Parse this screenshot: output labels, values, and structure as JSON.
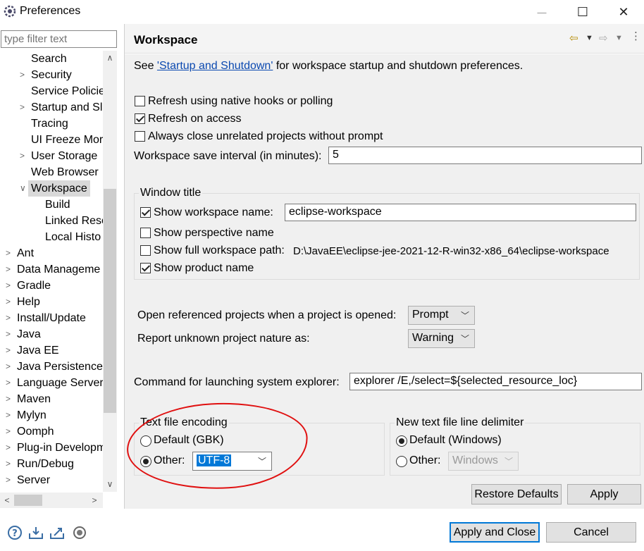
{
  "window": {
    "title": "Preferences",
    "minimize_glyph": "—",
    "maximize_glyph": "☐",
    "close_glyph": "✕"
  },
  "filter": {
    "placeholder": "type filter text"
  },
  "tree": {
    "items": [
      {
        "label": "Search",
        "arrow": ""
      },
      {
        "label": "Security",
        "arrow": ">"
      },
      {
        "label": "Service Policie",
        "arrow": ""
      },
      {
        "label": "Startup and Sl",
        "arrow": ">"
      },
      {
        "label": "Tracing",
        "arrow": ""
      },
      {
        "label": "UI Freeze Mor",
        "arrow": ""
      },
      {
        "label": "User Storage",
        "arrow": ">"
      },
      {
        "label": "Web Browser",
        "arrow": ""
      },
      {
        "label": "Workspace",
        "arrow": "v"
      },
      {
        "label": "Build",
        "arrow": ""
      },
      {
        "label": "Linked Reso",
        "arrow": ""
      },
      {
        "label": "Local Histo",
        "arrow": ""
      },
      {
        "label": "Ant",
        "arrow": ">"
      },
      {
        "label": "Data Manageme",
        "arrow": ">"
      },
      {
        "label": "Gradle",
        "arrow": ">"
      },
      {
        "label": "Help",
        "arrow": ">"
      },
      {
        "label": "Install/Update",
        "arrow": ">"
      },
      {
        "label": "Java",
        "arrow": ">"
      },
      {
        "label": "Java EE",
        "arrow": ">"
      },
      {
        "label": "Java Persistence",
        "arrow": ">"
      },
      {
        "label": "Language Server",
        "arrow": ">"
      },
      {
        "label": "Maven",
        "arrow": ">"
      },
      {
        "label": "Mylyn",
        "arrow": ">"
      },
      {
        "label": "Oomph",
        "arrow": ">"
      },
      {
        "label": "Plug-in Developm",
        "arrow": ">"
      },
      {
        "label": "Run/Debug",
        "arrow": ">"
      },
      {
        "label": "Server",
        "arrow": ">"
      }
    ]
  },
  "page": {
    "title": "Workspace",
    "see_prefix": "See ",
    "see_link": "'Startup and Shutdown'",
    "see_suffix": " for workspace startup and shutdown preferences.",
    "refresh_native": {
      "label": "Refresh using native hooks or polling",
      "checked": false
    },
    "refresh_access": {
      "label": "Refresh on access",
      "checked": true
    },
    "always_close": {
      "label": "Always close unrelated projects without prompt",
      "checked": false
    },
    "save_interval_label": "Workspace save interval (in minutes):",
    "save_interval_value": "5",
    "window_title": {
      "group_label": "Window title",
      "show_workspace_name": {
        "label": "Show workspace name:",
        "checked": true,
        "value": "eclipse-workspace"
      },
      "show_perspective_name": {
        "label": "Show perspective name",
        "checked": false
      },
      "show_full_path": {
        "label": "Show full workspace path:",
        "checked": false,
        "value": "D:\\JavaEE\\eclipse-jee-2021-12-R-win32-x86_64\\eclipse-workspace"
      },
      "show_product_name": {
        "label": "Show product name",
        "checked": true
      }
    },
    "open_referenced_label": "Open referenced projects when a project is opened:",
    "open_referenced_value": "Prompt",
    "report_unknown_label": "Report unknown project nature as:",
    "report_unknown_value": "Warning",
    "command_label": "Command for launching system explorer:",
    "command_value": "explorer /E,/select=${selected_resource_loc}",
    "encoding": {
      "group_label": "Text file encoding",
      "default_label": "Default (GBK)",
      "other_label": "Other:",
      "other_value": "UTF-8",
      "selected": "other"
    },
    "line_delimiter": {
      "group_label": "New text file line delimiter",
      "default_label": "Default (Windows)",
      "other_label": "Other:",
      "other_value": "Windows",
      "selected": "default"
    },
    "restore_defaults": "Restore Defaults",
    "apply": "Apply"
  },
  "footer": {
    "apply_and_close": "Apply and Close",
    "cancel": "Cancel"
  },
  "colors": {
    "link": "#0b49b0",
    "selection": "#0078d7",
    "annotation": "#e01010"
  }
}
